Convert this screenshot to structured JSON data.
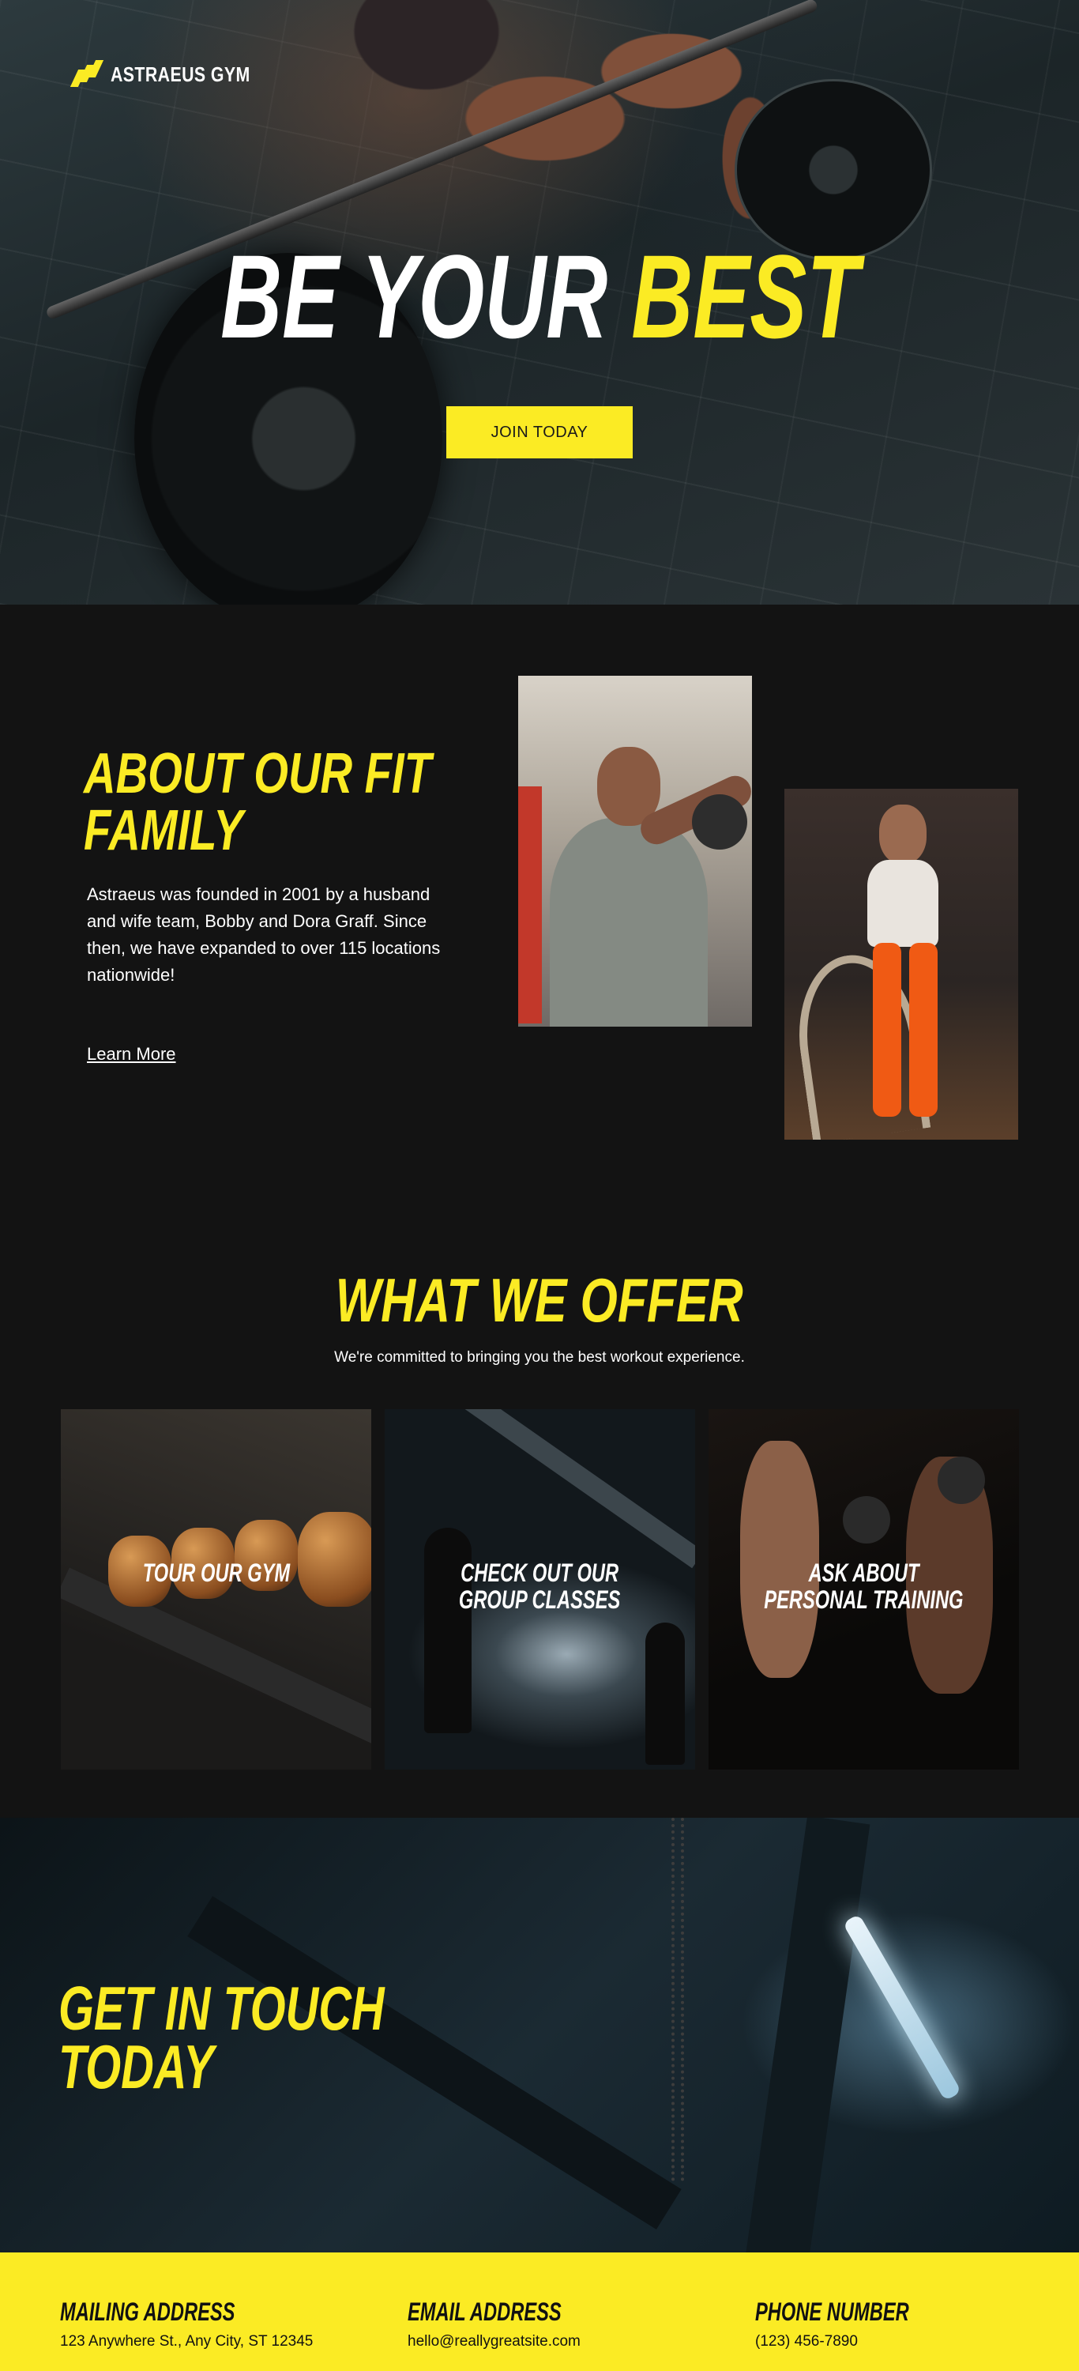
{
  "brand": {
    "name": "ASTRAEUS GYM",
    "accent": "#fbeb24",
    "background": "#131313"
  },
  "hero": {
    "title_white": "BE YOUR",
    "title_yellow": "BEST",
    "cta_label": "JOIN TODAY"
  },
  "about": {
    "title_line1": "ABOUT OUR FIT",
    "title_line2": "FAMILY",
    "body": "Astraeus was founded in 2001 by a husband and wife team, Bobby and Dora Graff. Since then, we have expanded to over 115 locations nationwide!",
    "link_label": "Learn More"
  },
  "offer": {
    "title": "WHAT WE OFFER",
    "subtitle": "We're committed to bringing you the best workout experience.",
    "cards": [
      {
        "line1": "TOUR OUR GYM",
        "line2": ""
      },
      {
        "line1": "CHECK OUT OUR",
        "line2": "GROUP CLASSES"
      },
      {
        "line1": "ASK ABOUT",
        "line2": "PERSONAL TRAINING"
      }
    ]
  },
  "contact": {
    "title_line1": "GET IN TOUCH",
    "title_line2": "TODAY"
  },
  "footer": {
    "mailing": {
      "heading": "MAILING ADDRESS",
      "value": "123 Anywhere St., Any City, ST 12345"
    },
    "email": {
      "heading": "EMAIL ADDRESS",
      "value": "hello@reallygreatsite.com"
    },
    "phone": {
      "heading": "PHONE NUMBER",
      "value": "(123) 456-7890"
    }
  }
}
